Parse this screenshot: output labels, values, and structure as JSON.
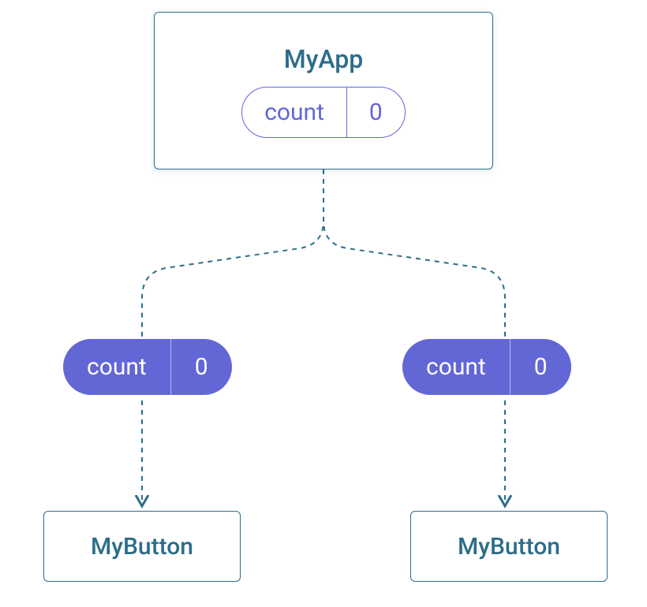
{
  "root": {
    "title": "MyApp",
    "state": {
      "label": "count",
      "value": "0"
    }
  },
  "leftProp": {
    "label": "count",
    "value": "0"
  },
  "rightProp": {
    "label": "count",
    "value": "0"
  },
  "leftButton": {
    "label": "MyButton"
  },
  "rightButton": {
    "label": "MyButton"
  },
  "colors": {
    "line": "#2b6d8a",
    "pill": "#6366d5"
  }
}
